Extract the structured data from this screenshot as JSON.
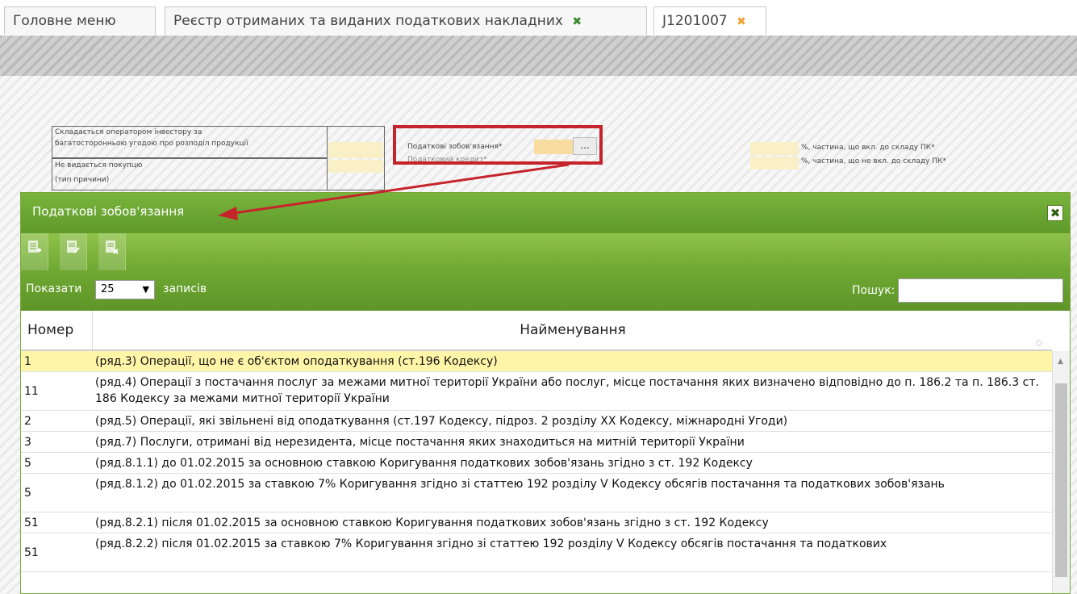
{
  "tabs": [
    {
      "label": "Головне меню",
      "close": ""
    },
    {
      "label": "Реєстр отриманих та виданих податкових накладних",
      "close": "✖"
    },
    {
      "label": "J1201007",
      "close": "✖"
    }
  ],
  "background_form": {
    "line1": "Складається оператором інвестору за",
    "line2": "багатосторонньою угодою про розподіл продукції",
    "line3": "Не видається покупцю",
    "line4": "(тип причини)",
    "tax_obligations": "Податкові зобов'язання*",
    "tax_credit": "Податковий кредит*",
    "dots_button": "...",
    "pct_included": "%, частина, що вкл. до складу ПК*",
    "pct_not_included": "%, частина, що не вкл. до складу ПК*"
  },
  "modal": {
    "title": "Податкові зобов'язання",
    "close": "✖",
    "show_label": "Показати",
    "page_size": "25",
    "records_label": "записів",
    "search_label": "Пошук:",
    "search_value": "",
    "columns": {
      "number": "Номер",
      "name": "Найменування"
    },
    "rows": [
      {
        "num": "1",
        "name": "(ряд.3) Операції, що не є об'єктом оподаткування (ст.196 Кодексу)"
      },
      {
        "num": "11",
        "name": "(ряд.4) Операції з постачання послуг за межами митної території України або послуг, місце постачання яких визначено відповідно до п. 186.2 та п. 186.3 ст. 186 Кодексу за межами митної території України"
      },
      {
        "num": "2",
        "name": "(ряд.5) Операції, які звільнені від оподаткування (ст.197 Кодексу, підроз. 2 розділу XX Кодексу, міжнародні Угоди)"
      },
      {
        "num": "3",
        "name": "(ряд.7) Послуги, отримані від нерезидента, місце постачання яких знаходиться на митній території України"
      },
      {
        "num": "5",
        "name": "(ряд.8.1.1) до 01.02.2015 за основною ставкою Коригування податкових зобов'язань згідно з ст. 192 Кодексу"
      },
      {
        "num": "5",
        "name": "(ряд.8.1.2) до 01.02.2015 за ставкою 7% Коригування згідно зі статтею 192 розділу V Кодексу обсягів постачання та податкових зобов'язань"
      },
      {
        "num": "51",
        "name": "(ряд.8.2.1) після 01.02.2015 за основною ставкою Коригування податкових зобов'язань згідно з ст. 192 Кодексу"
      },
      {
        "num": "51",
        "name": "(ряд.8.2.2) після 01.02.2015 за ставкою 7% Коригування згідно зі статтею 192 розділу V Кодексу обсягів постачання та податкових"
      }
    ]
  },
  "colors": {
    "accent_green": "#6fa832",
    "highlight_red": "#c5242b",
    "selected_row": "#fff5a8"
  }
}
